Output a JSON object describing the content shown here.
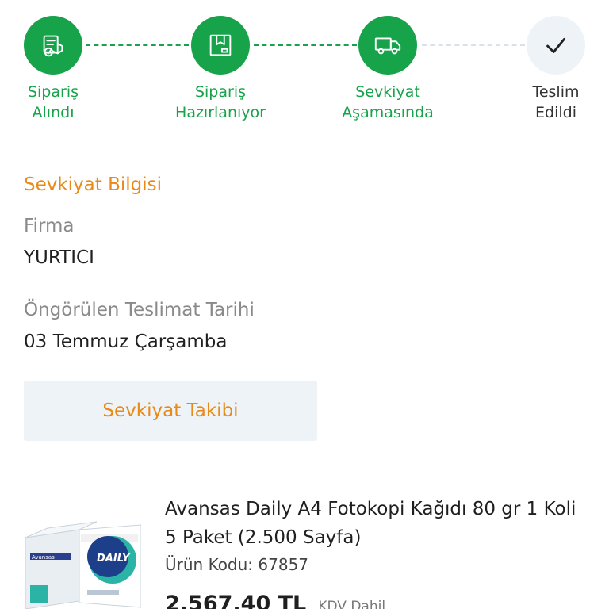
{
  "stepper": {
    "steps": [
      {
        "label": "Sipariş\nAlındı",
        "status": "done",
        "icon": "order-received-icon"
      },
      {
        "label": "Sipariş\nHazırlanıyor",
        "status": "done",
        "icon": "package-box-icon"
      },
      {
        "label": "Sevkiyat\nAşamasında",
        "status": "done",
        "icon": "delivery-truck-icon"
      },
      {
        "label": "Teslim\nEdildi",
        "status": "pending",
        "icon": "checkmark-icon"
      }
    ],
    "colors": {
      "done": "#16a34a",
      "pending": "#eef3f8"
    }
  },
  "shipping": {
    "title": "Sevkiyat Bilgisi",
    "company_label": "Firma",
    "company_value": "YURTICI",
    "date_label": "Öngörülen Teslimat Tarihi",
    "date_value": "03 Temmuz Çarşamba",
    "track_button": "Sevkiyat Takibi",
    "accent_color": "#e88a17"
  },
  "product": {
    "name": "Avansas Daily A4 Fotokopi Kağıdı 80 gr 1 Koli 5 Paket (2.500 Sayfa)",
    "code": "Ürün Kodu: 67857",
    "price": "2.567,40 TL",
    "tax_note": "KDV Dahil",
    "image_icon": "paper-box-product-image"
  }
}
